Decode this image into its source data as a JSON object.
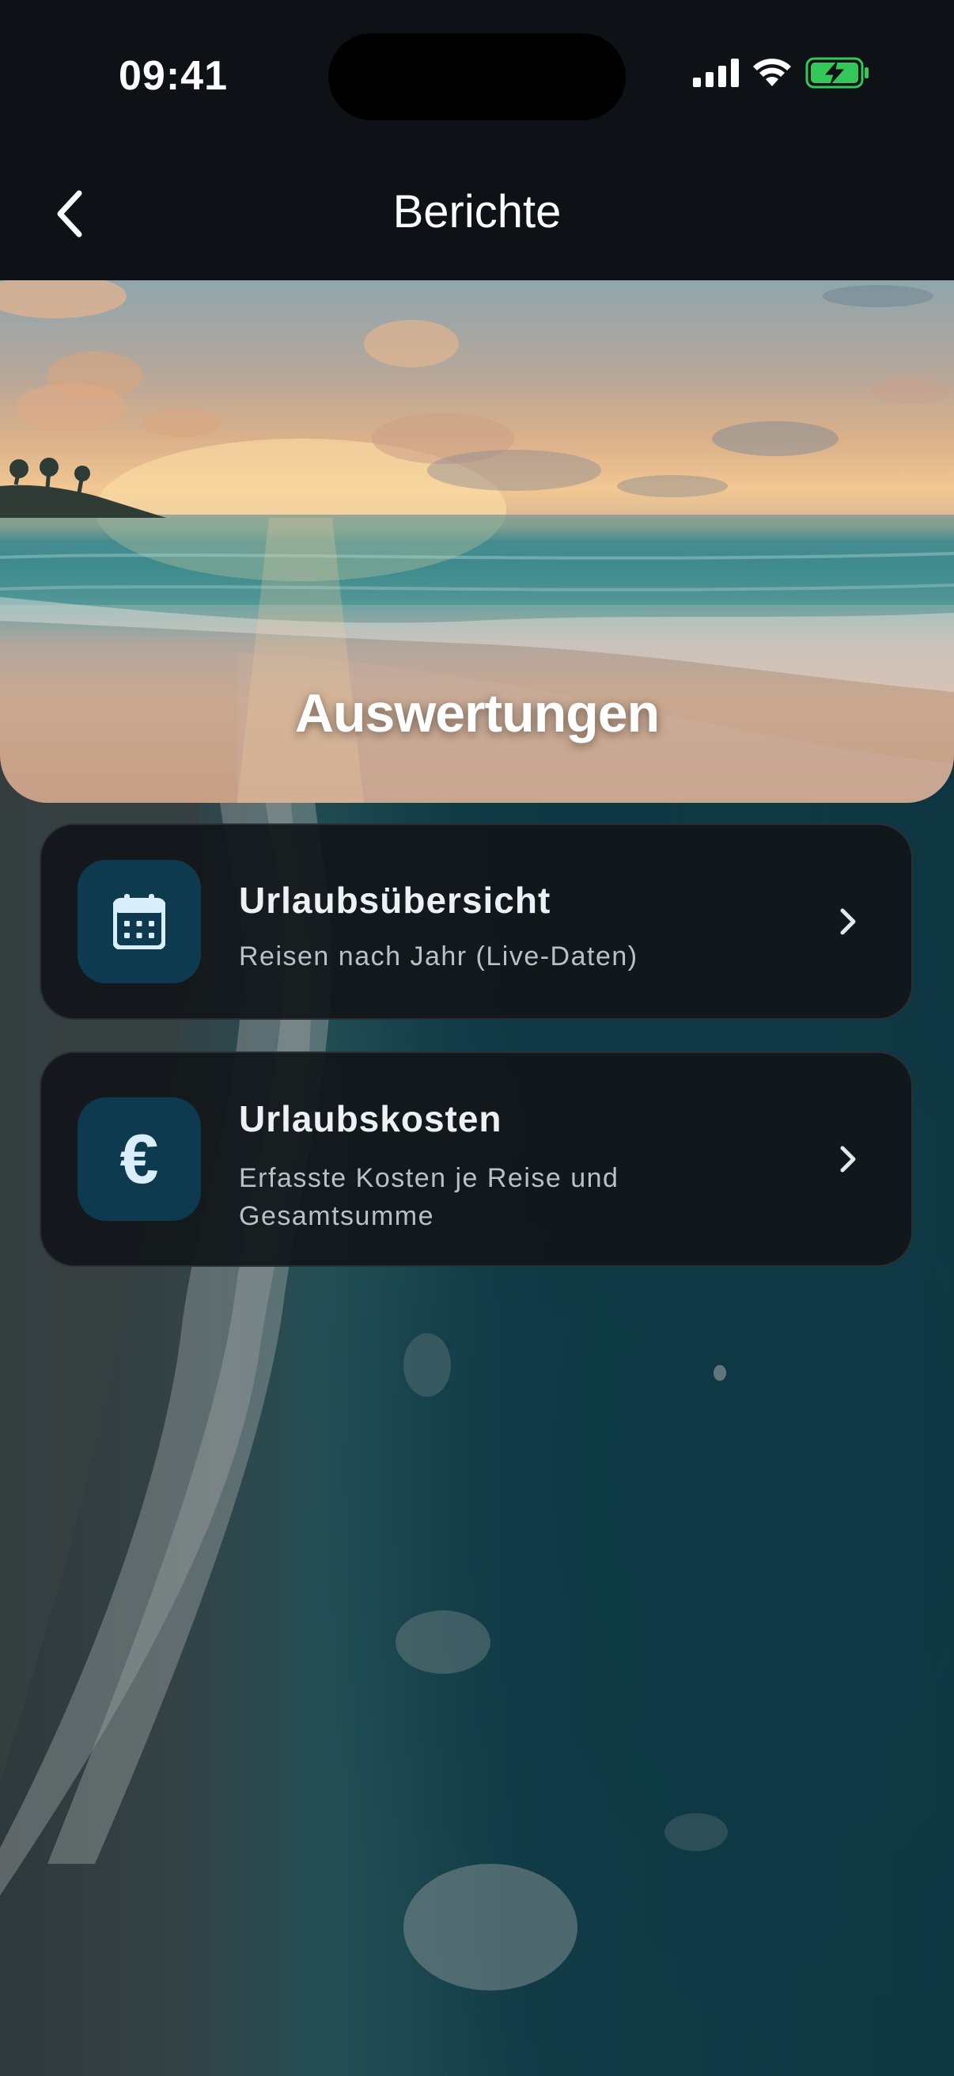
{
  "status_bar": {
    "time": "09:41"
  },
  "nav": {
    "title": "Berichte"
  },
  "hero": {
    "title": "Auswertungen"
  },
  "reports": [
    {
      "title": "Urlaubsübersicht",
      "subtitle": "Reisen nach Jahr (Live-Daten)",
      "icon": "calendar-icon"
    },
    {
      "title": "Urlaubskosten",
      "subtitle": "Erfasste Kosten je Reise und Gesamtsumme",
      "icon": "euro-icon",
      "icon_glyph": "€"
    }
  ],
  "colors": {
    "background": "#0e1216",
    "card_background": "#12161a",
    "card_border": "#2a2f35",
    "icon_tile": "#0e3a4f",
    "battery": "#34c759"
  }
}
